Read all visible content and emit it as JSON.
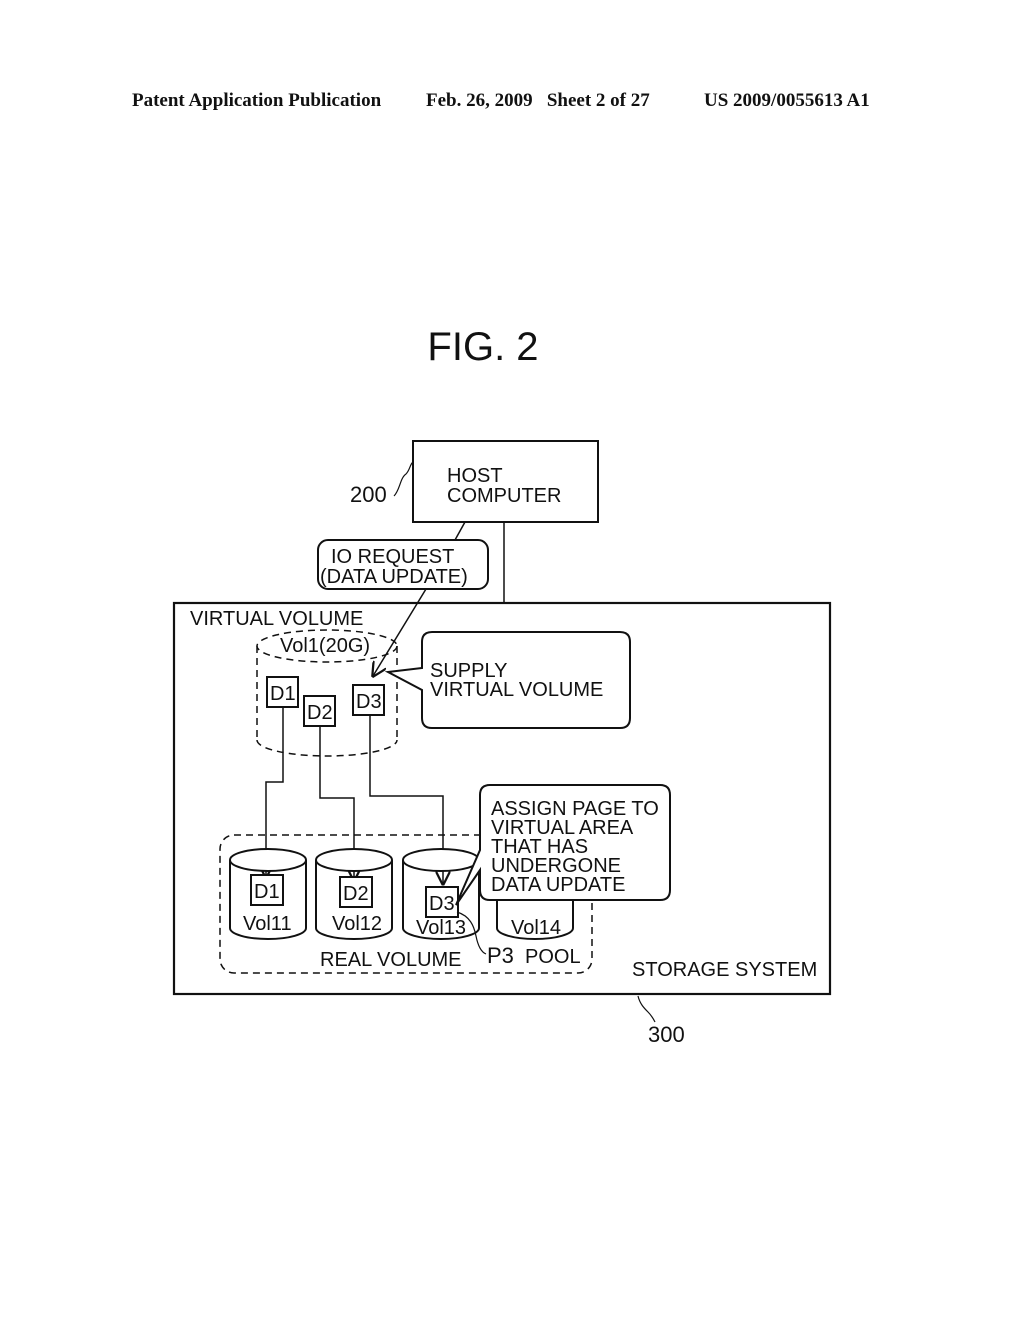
{
  "header": {
    "publication": "Patent Application Publication",
    "date_sheet": "Feb. 26, 2009   Sheet 2 of 27",
    "patent_number": "US 2009/0055613 A1"
  },
  "figure": {
    "title": "FIG. 2",
    "host": {
      "ref": "200",
      "line1": "HOST",
      "line2": "COMPUTER"
    },
    "io_request": {
      "line1": "IO REQUEST",
      "line2": "(DATA UPDATE)"
    },
    "storage": {
      "label": "STORAGE SYSTEM",
      "ref": "300"
    },
    "virtual_volume": {
      "label": "VIRTUAL VOLUME",
      "volume": "Vol1(20G)",
      "blocks": [
        "D1",
        "D2",
        "D3"
      ]
    },
    "supply_callout": {
      "line1": "SUPPLY",
      "line2": "VIRTUAL VOLUME"
    },
    "assign_callout": {
      "lines": [
        "ASSIGN PAGE TO",
        "VIRTUAL AREA",
        "THAT HAS",
        "UNDERGONE",
        "DATA UPDATE"
      ]
    },
    "pool": {
      "real_volume_label": "REAL VOLUME",
      "page_label": "P3",
      "pool_label": "POOL",
      "volumes": [
        {
          "name": "Vol11",
          "block": "D1"
        },
        {
          "name": "Vol12",
          "block": "D2"
        },
        {
          "name": "Vol13",
          "block": "D3"
        },
        {
          "name": "Vol14",
          "block": ""
        }
      ]
    }
  }
}
